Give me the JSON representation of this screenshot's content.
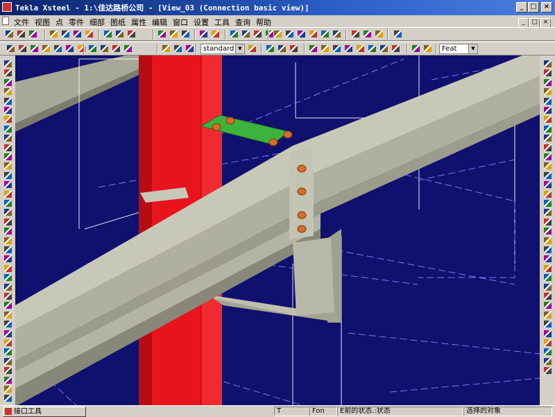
{
  "window": {
    "title": "Tekla Xsteel - 1:\\佳达路桥公司 - [View_03 (Connection basic view)]"
  },
  "menu": {
    "items": [
      "文件",
      "视图",
      "点",
      "零件",
      "细部",
      "图纸",
      "属性",
      "编辑",
      "窗口",
      "设置",
      "工具",
      "查询",
      "帮助"
    ]
  },
  "toolbar2": {
    "view_combo": "standard",
    "snap_combo": "Feat"
  },
  "status": {
    "taskbar_label": "接口工具",
    "field_t": "T",
    "field_fon": "Fon",
    "field_state": "E前的状态.:状态",
    "field_select": "选择的对象"
  },
  "colors": {
    "viewport_bg": "#10106e",
    "column": "#e8141c",
    "beam": "#b8b8a8",
    "plate": "#3cb43c",
    "bolt": "#d86c28"
  }
}
